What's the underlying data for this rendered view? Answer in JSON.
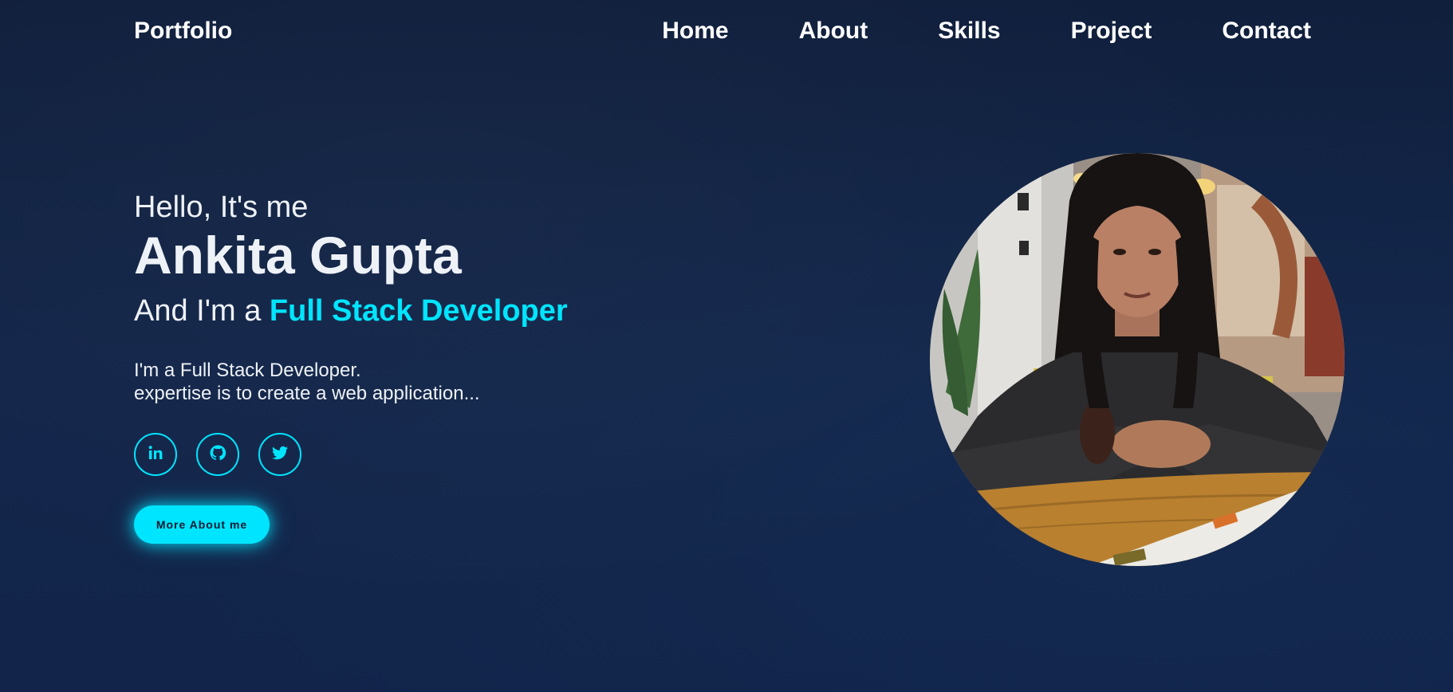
{
  "header": {
    "logo": "Portfolio",
    "nav": [
      {
        "label": "Home"
      },
      {
        "label": "About"
      },
      {
        "label": "Skills"
      },
      {
        "label": "Project"
      },
      {
        "label": "Contact"
      }
    ]
  },
  "hero": {
    "greeting": "Hello, It's me",
    "name": "Ankita Gupta",
    "role_prefix": "And I'm a ",
    "role_highlight": "Full Stack Developer",
    "description_lines": [
      "I'm a Full Stack Developer.",
      "expertise is to create a web application..."
    ],
    "socials": [
      {
        "icon": "linkedin-icon"
      },
      {
        "icon": "github-icon"
      },
      {
        "icon": "twitter-icon"
      }
    ],
    "cta_label": "More About me"
  },
  "colors": {
    "background": "#112140",
    "accent": "#00e5ff",
    "text": "#eef2f7"
  }
}
